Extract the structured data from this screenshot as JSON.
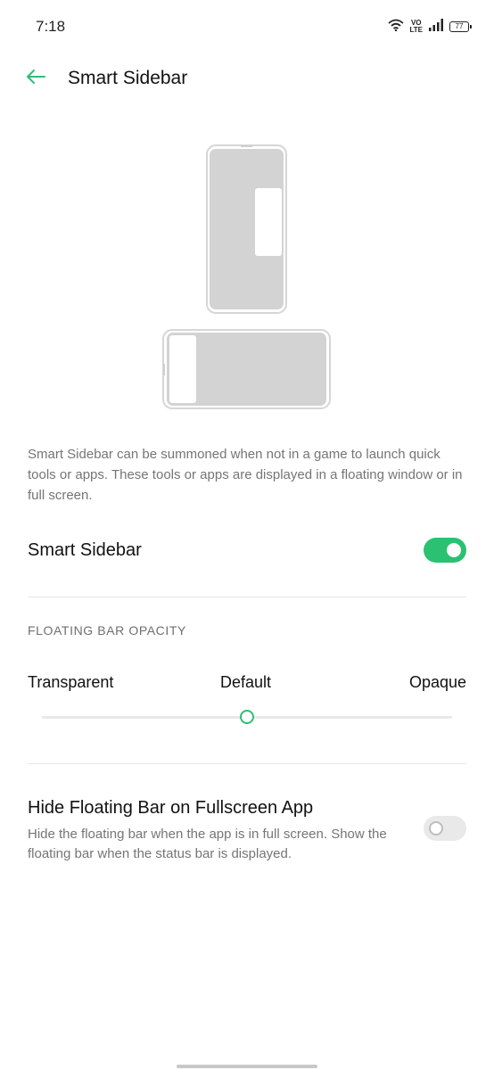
{
  "status_bar": {
    "time": "7:18",
    "icons": [
      "wifi-icon",
      "volte-icon",
      "signal-icon",
      "battery-icon"
    ],
    "volte_top": "VO",
    "volte_bottom": "LTE",
    "battery_level": "77"
  },
  "app_bar": {
    "back_icon": "arrow-left-icon",
    "title": "Smart Sidebar"
  },
  "description": "Smart Sidebar can be summoned when not in a game to launch quick tools or apps. These tools or apps are displayed in a floating window or in full screen.",
  "smart_sidebar": {
    "label": "Smart Sidebar",
    "enabled": true
  },
  "opacity": {
    "header": "FLOATING BAR OPACITY",
    "label_min": "Transparent",
    "label_mid": "Default",
    "label_max": "Opaque",
    "value_fraction": 0.5
  },
  "hide_floating_bar": {
    "label": "Hide Floating Bar on Fullscreen App",
    "subtitle": "Hide the floating bar when the app is in full screen. Show the floating bar when the status bar is displayed.",
    "enabled": false
  },
  "colors": {
    "accent": "#2bc173",
    "toggle_off": "#e9e9e9",
    "text_primary": "#111111",
    "text_secondary": "#757575"
  }
}
